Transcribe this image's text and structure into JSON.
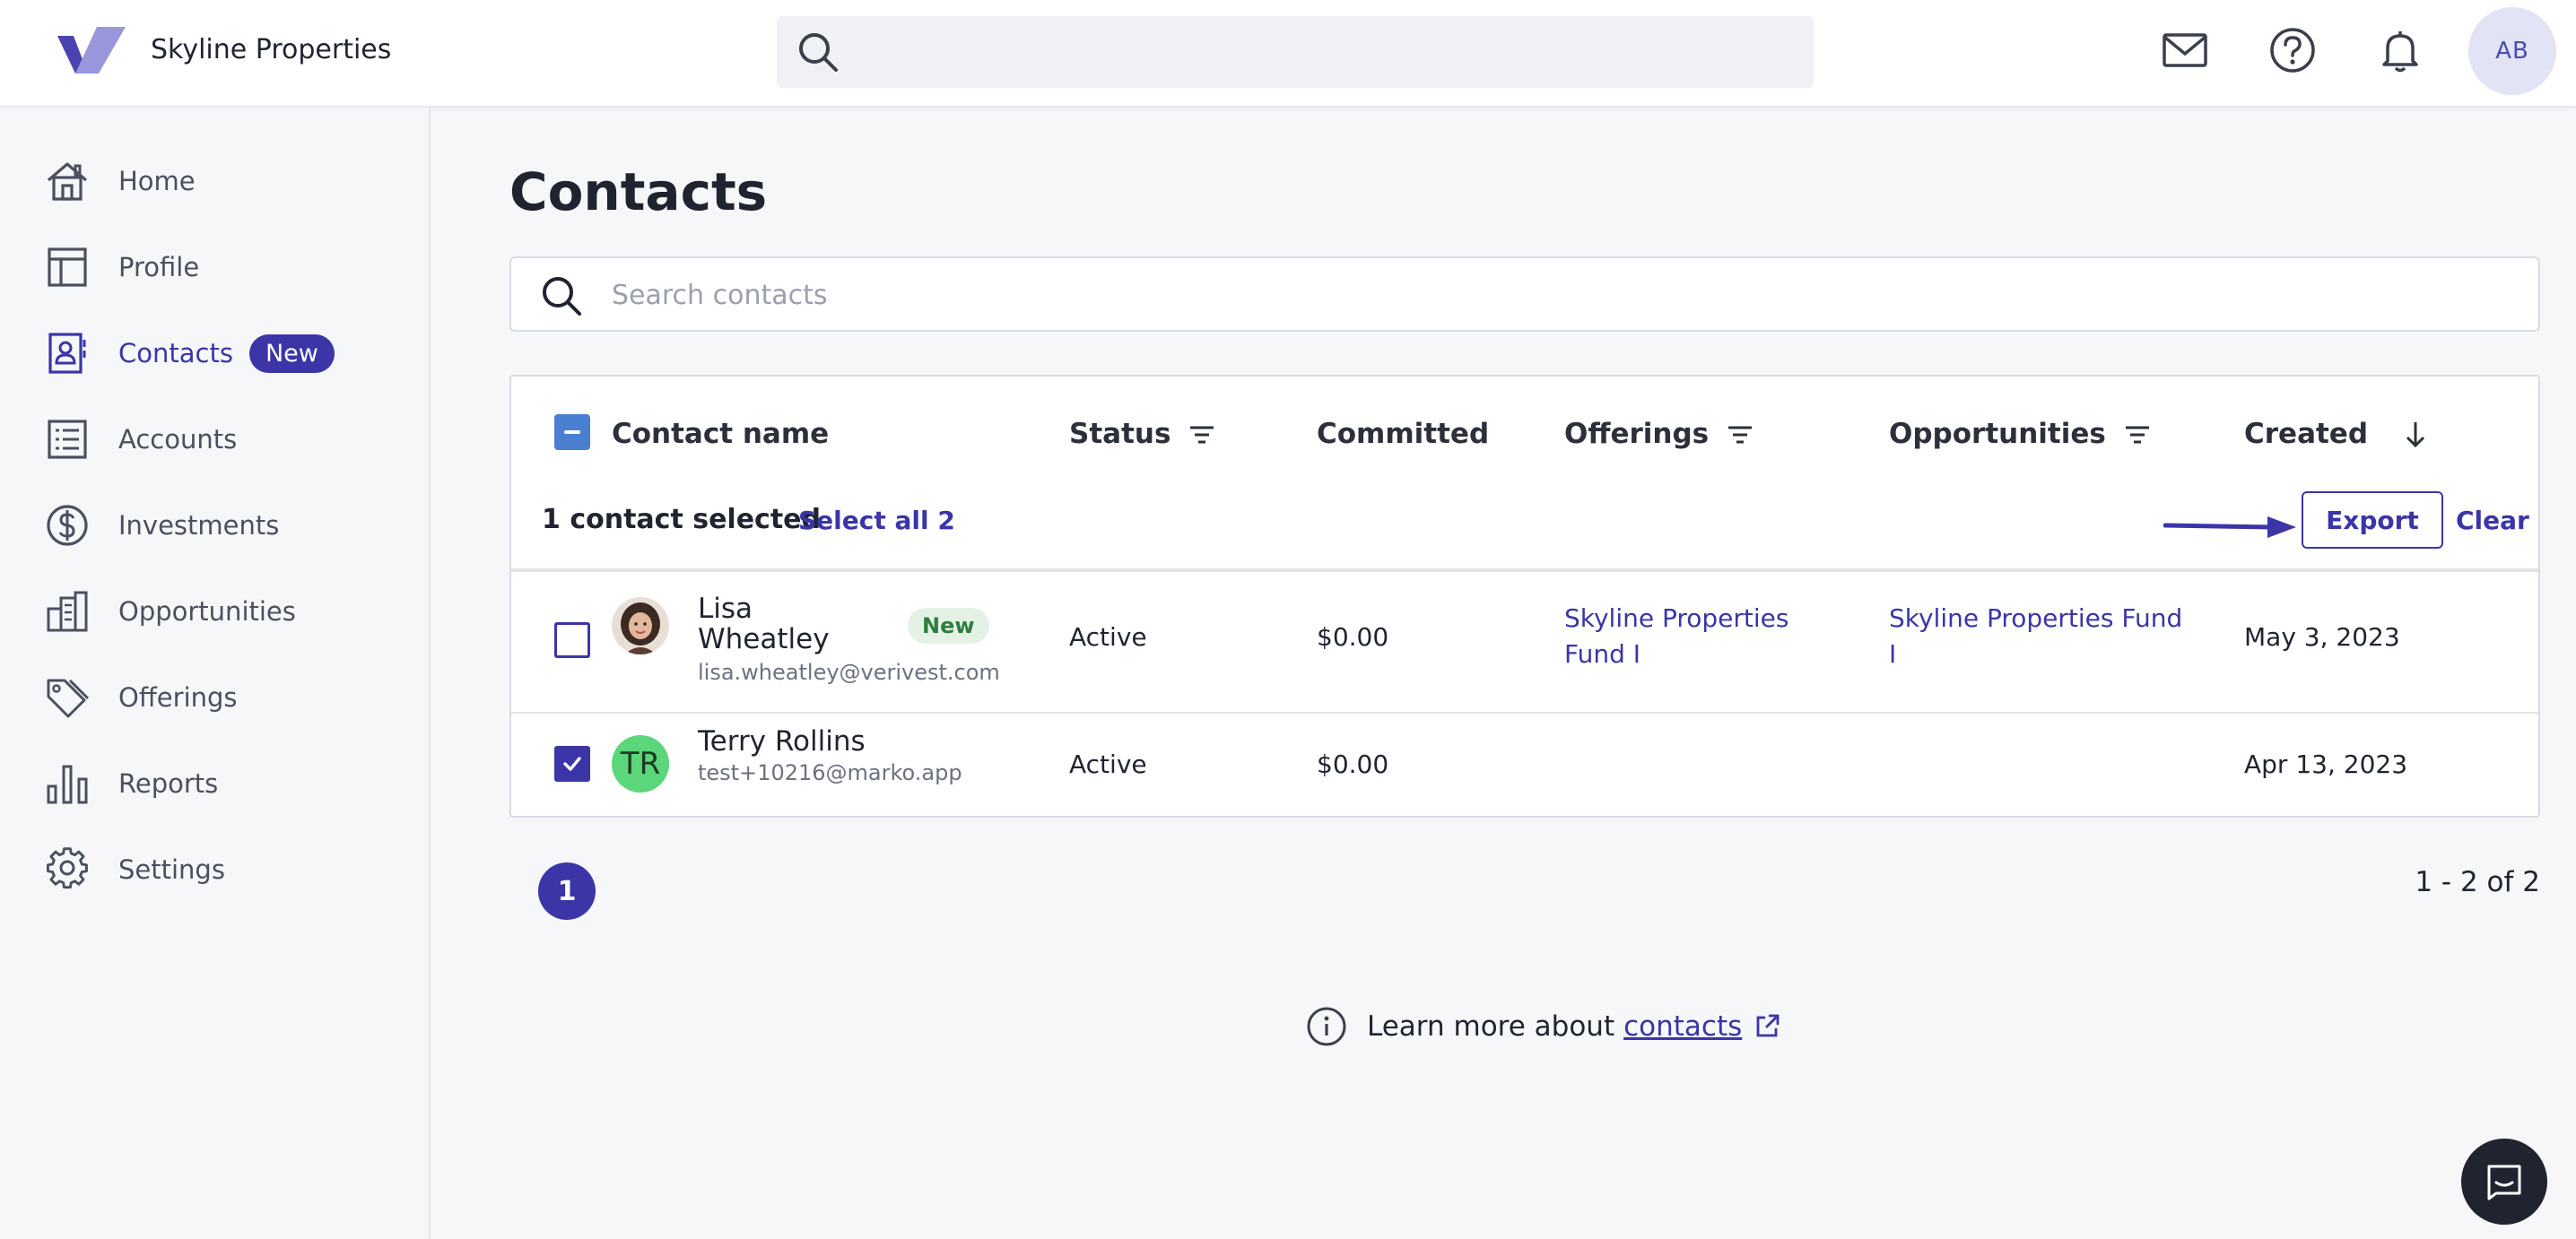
{
  "header": {
    "brand": "Skyline Properties",
    "avatar_initials": "AB",
    "icons": [
      "mail-icon",
      "help-icon",
      "bell-icon"
    ]
  },
  "sidebar": {
    "items": [
      {
        "label": "Home",
        "icon": "home-icon"
      },
      {
        "label": "Profile",
        "icon": "layout-icon"
      },
      {
        "label": "Contacts",
        "icon": "contact-card-icon",
        "badge": "New",
        "active": true
      },
      {
        "label": "Accounts",
        "icon": "list-icon"
      },
      {
        "label": "Investments",
        "icon": "dollar-icon"
      },
      {
        "label": "Opportunities",
        "icon": "buildings-icon"
      },
      {
        "label": "Offerings",
        "icon": "tags-icon"
      },
      {
        "label": "Reports",
        "icon": "bar-chart-icon"
      },
      {
        "label": "Settings",
        "icon": "gear-icon"
      }
    ]
  },
  "main": {
    "title": "Contacts",
    "search_placeholder": "Search contacts",
    "table": {
      "columns": [
        "Contact name",
        "Status",
        "Committed",
        "Offerings",
        "Opportunities",
        "Created"
      ],
      "selection": {
        "text": "1 contact selected",
        "select_all": "Select all 2",
        "export": "Export",
        "clear": "Clear"
      },
      "rows": [
        {
          "name_line1": "Lisa",
          "name_line2": "Wheatley",
          "email": "lisa.wheatley@verivest.com",
          "badge": "New",
          "status": "Active",
          "committed": "$0.00",
          "offerings_line1": "Skyline Properties",
          "offerings_line2": "Fund I",
          "opportunities_line1": "Skyline Properties Fund",
          "opportunities_line2": "I",
          "created": "May 3, 2023",
          "checked": false
        },
        {
          "name_line1": "Terry Rollins",
          "initials": "TR",
          "email": "test+10216@marko.app",
          "status": "Active",
          "committed": "$0.00",
          "created": "Apr 13, 2023",
          "checked": true
        }
      ]
    },
    "pagination": {
      "current_page": "1",
      "range": "1 - 2 of 2"
    },
    "learn_more": {
      "text": "Learn more about",
      "link": "contacts"
    }
  },
  "colors": {
    "accent": "#3b35a8",
    "checkbox_blue": "#4a7fd0",
    "avatar_green": "#5bd67a"
  }
}
